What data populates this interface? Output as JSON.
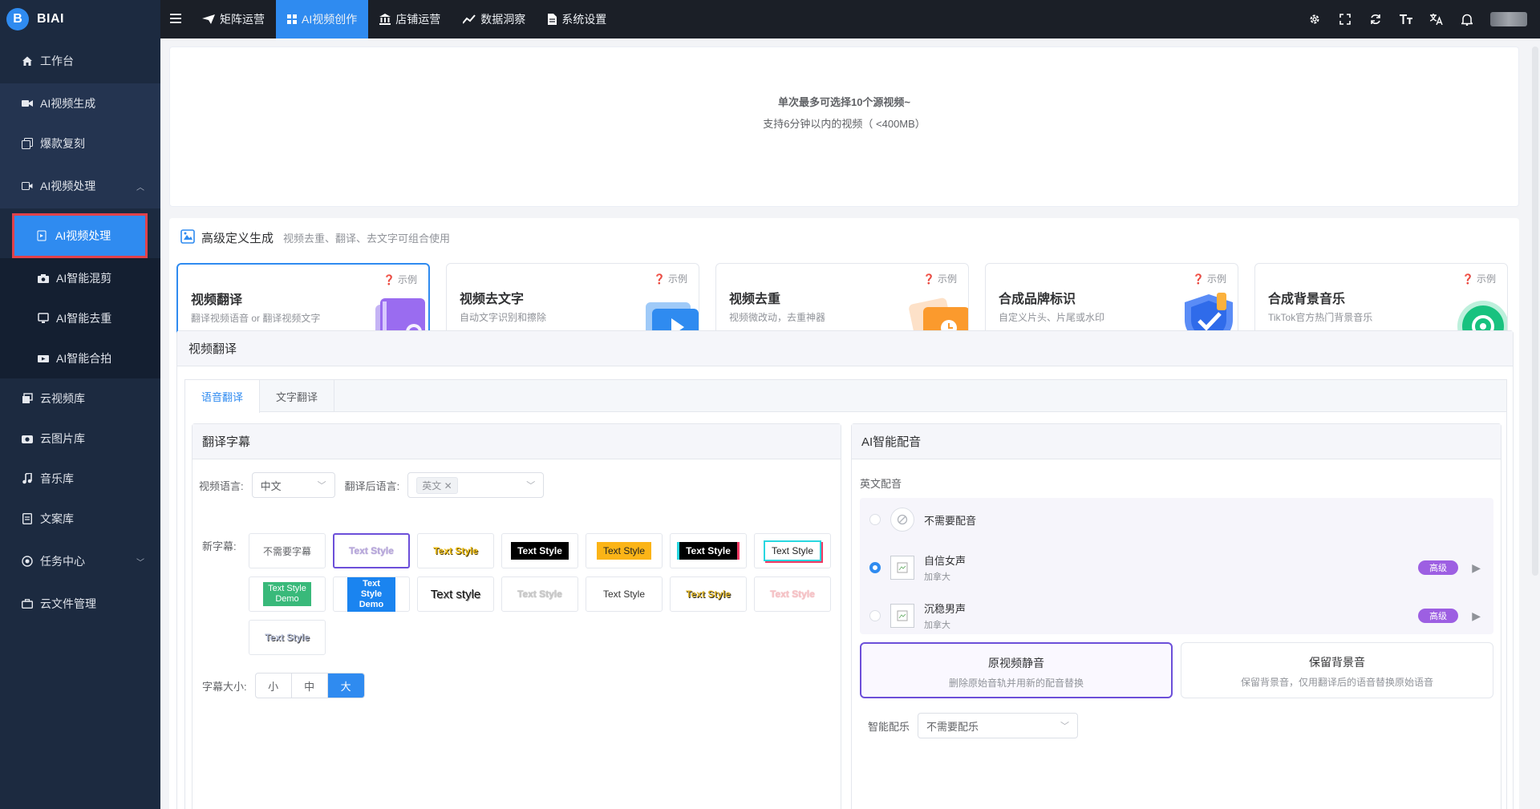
{
  "brand": {
    "name": "BIAI"
  },
  "sidebar": {
    "items": [
      {
        "label": "工作台"
      },
      {
        "label": "AI视频生成"
      },
      {
        "label": "爆款复刻"
      },
      {
        "label": "AI视频处理"
      },
      {
        "label": "AI视频处理"
      },
      {
        "label": "AI智能混剪"
      },
      {
        "label": "AI智能去重"
      },
      {
        "label": "AI智能合拍"
      },
      {
        "label": "云视频库"
      },
      {
        "label": "云图片库"
      },
      {
        "label": "音乐库"
      },
      {
        "label": "文案库"
      },
      {
        "label": "任务中心"
      },
      {
        "label": "云文件管理"
      }
    ]
  },
  "topnav": {
    "items": [
      {
        "label": "矩阵运营"
      },
      {
        "label": "AI视频创作"
      },
      {
        "label": "店铺运营"
      },
      {
        "label": "数据洞察"
      },
      {
        "label": "系统设置"
      }
    ]
  },
  "upload": {
    "line1": "单次最多可选择10个源视频~",
    "line2": "支持6分钟以内的视频（ <400MB）"
  },
  "custom": {
    "title": "高级定义生成",
    "subtitle": "视频去重、翻译、去文字可组合使用",
    "example_label": "示例",
    "cards": [
      {
        "title": "视频翻译",
        "desc": "翻译视频语音 or 翻译视频文字"
      },
      {
        "title": "视频去文字",
        "desc": "自动文字识别和擦除"
      },
      {
        "title": "视频去重",
        "desc": "视频微改动，去重神器"
      },
      {
        "title": "合成品牌标识",
        "desc": "自定义片头、片尾或水印"
      },
      {
        "title": "合成背景音乐",
        "desc": "TikTok官方热门背景音乐"
      }
    ]
  },
  "translate": {
    "title": "视频翻译",
    "tabs": [
      "语音翻译",
      "文字翻译"
    ],
    "subtitle_box": {
      "title": "翻译字幕",
      "video_lang_label": "视频语言:",
      "video_lang_value": "中文",
      "target_lang_label": "翻译后语言:",
      "target_lang_tag": "英文",
      "new_subtitle_label": "新字幕:",
      "styles": [
        "不需要字幕",
        "Text Style",
        "Text Style",
        "Text Style",
        "Text Style",
        "Text Style",
        "Text Style",
        "Text Style Demo",
        "Text Style Demo",
        "Text style",
        "Text Style",
        "Text Style",
        "Text Style",
        "Text Style",
        "Text Style"
      ],
      "size_label": "字幕大小:",
      "sizes": [
        "小",
        "中",
        "大"
      ]
    },
    "dub_box": {
      "title": "AI智能配音",
      "section": "英文配音",
      "voices": [
        {
          "name": "不需要配音",
          "region": ""
        },
        {
          "name": "自信女声",
          "region": "加拿大",
          "badge": "高级"
        },
        {
          "name": "沉稳男声",
          "region": "加拿大",
          "badge": "高级"
        }
      ],
      "options": [
        {
          "title": "原视频静音",
          "desc": "删除原始音轨并用新的配音替换"
        },
        {
          "title": "保留背景音",
          "desc": "保留背景音，仅用翻译后的语音替换原始语音"
        }
      ],
      "music_label": "智能配乐",
      "music_value": "不需要配乐"
    }
  },
  "colors": {
    "accent": "#2f8bf0",
    "sidebar_bg": "#1c2a40",
    "topbar_bg": "#1b1f27",
    "purple": "#6c4fd9",
    "badge": "#9d5fe2"
  }
}
